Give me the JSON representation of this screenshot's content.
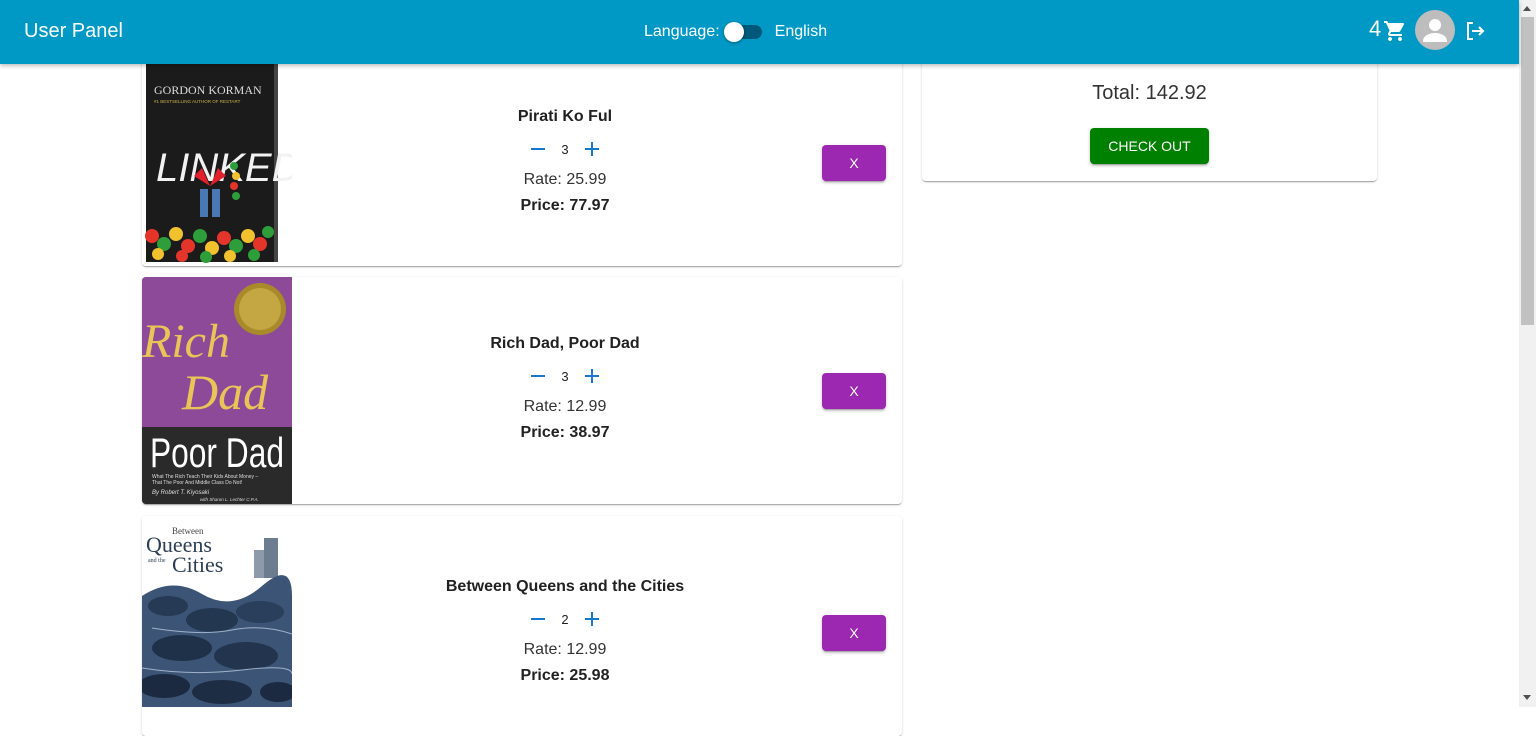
{
  "header": {
    "title": "User Panel",
    "language_label": "Language:",
    "language_value": "English",
    "cart_count": "4",
    "brand_color": "#0099c6"
  },
  "cart": {
    "items": [
      {
        "title": "Pirati Ko Ful",
        "quantity": "3",
        "rate": "Rate: 25.99",
        "price": "Price: 77.97",
        "remove_label": "X",
        "cover": {
          "author": "GORDON KORMAN",
          "tagline": "#1 BESTSELLING AUTHOR OF RESTART",
          "title": "LINKED"
        }
      },
      {
        "title": "Rich Dad, Poor Dad",
        "quantity": "3",
        "rate": "Rate: 12.99",
        "price": "Price: 38.97",
        "remove_label": "X",
        "cover": {
          "title_top": "Rich",
          "title_mid": "Dad",
          "title_bottom": "Poor Dad",
          "subtitle": "What The Rich Teach Their Kids About Money –",
          "subtitle2": "That The Poor And Middle Class Do Not!",
          "author": "By Robert T. Kiyosaki",
          "coauthor": "with Sharon L. Lechter C.P.A."
        }
      },
      {
        "title": "Between Queens and the Cities",
        "quantity": "2",
        "rate": "Rate: 12.99",
        "price": "Price: 25.98",
        "remove_label": "X",
        "cover": {
          "small": "Between",
          "queens": "Queens",
          "and": "and the",
          "cities": "Cities"
        }
      }
    ]
  },
  "summary": {
    "total": "Total: 142.92",
    "checkout_label": "CHECK OUT",
    "checkout_color": "#008000"
  },
  "colors": {
    "remove_button": "#9c27b0",
    "qty_icon": "#1976d2"
  }
}
